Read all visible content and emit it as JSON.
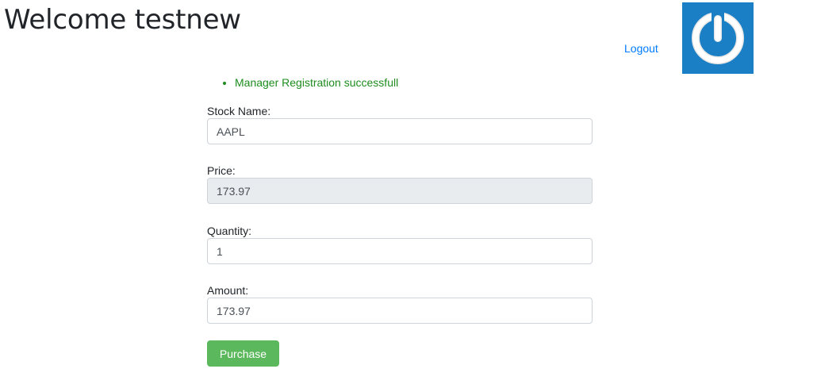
{
  "header": {
    "title": "Welcome testnew",
    "logout_label": "Logout",
    "power_icon": "power-icon",
    "power_tile_color": "#1a7fc4"
  },
  "alerts": [
    "Manager Registration successfull"
  ],
  "form": {
    "stock_name": {
      "label": "Stock Name:",
      "value": "AAPL"
    },
    "price": {
      "label": "Price:",
      "value": "173.97"
    },
    "quantity": {
      "label": "Quantity:",
      "value": "1"
    },
    "amount": {
      "label": "Amount:",
      "value": "173.97"
    },
    "purchase_label": "Purchase"
  },
  "colors": {
    "link": "#007bff",
    "success_text": "#1e8c1e",
    "purchase_button": "#5cb85c"
  }
}
